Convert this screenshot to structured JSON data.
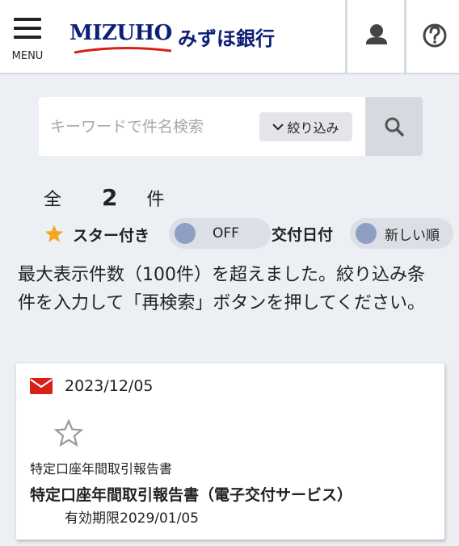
{
  "header": {
    "menu_label": "MENU",
    "logo_latin": "MIZUHO",
    "logo_jp": "みずほ銀行",
    "icons": {
      "menu": "hamburger-icon",
      "user": "user-icon",
      "help": "help-icon"
    },
    "colors": {
      "brand_navy": "#0d1f77",
      "brand_red": "#d8201a"
    }
  },
  "search": {
    "placeholder": "キーワードで件名検索",
    "value": "",
    "filter_label": "絞り込み",
    "filter_icon": "chevron-down-icon",
    "button_icon": "search-icon"
  },
  "results": {
    "prefix": "全",
    "count": "2",
    "suffix": "件"
  },
  "filters": {
    "star_label": "スター付き",
    "star_toggle": "OFF",
    "date_label": "交付日付",
    "sort_value": "新しい順",
    "star_color": "#f5a623"
  },
  "notice": "最大表示件数（100件）を超えました。絞り込み条件を入力して「再検索」ボタンを押してください。",
  "documents": [
    {
      "date": "2023/12/05",
      "status_icon": "mail-icon",
      "starred": false,
      "category": "特定口座年間取引報告書",
      "title": "特定口座年間取引報告書（電子交付サービス）",
      "expiry": "有効期限2029/01/05"
    }
  ]
}
